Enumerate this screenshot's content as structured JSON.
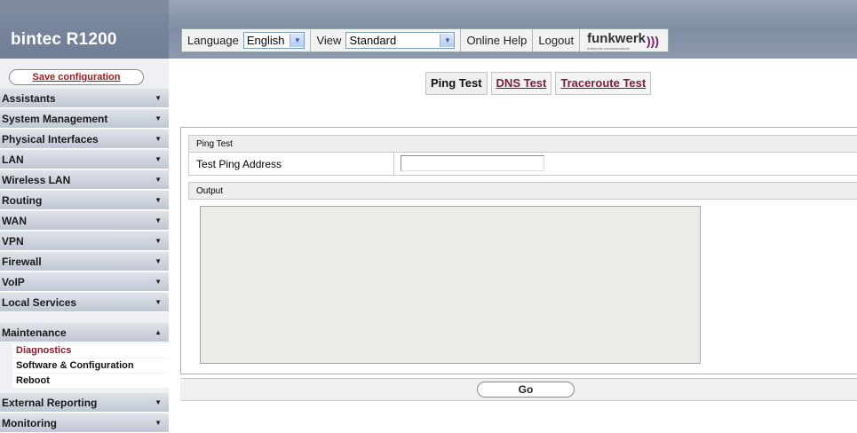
{
  "header": {
    "product": "bintec R1200",
    "language_label": "Language",
    "language_value": "English",
    "view_label": "View",
    "view_value": "Standard",
    "online_help": "Online Help",
    "logout": "Logout",
    "logo_text": "funkwerk",
    "logo_sub": "enterprise communications"
  },
  "sidebar": {
    "save_label": "Save configuration",
    "items": [
      {
        "label": "Assistants"
      },
      {
        "label": "System Management"
      },
      {
        "label": "Physical Interfaces"
      },
      {
        "label": "LAN"
      },
      {
        "label": "Wireless LAN"
      },
      {
        "label": "Routing"
      },
      {
        "label": "WAN"
      },
      {
        "label": "VPN"
      },
      {
        "label": "Firewall"
      },
      {
        "label": "VoIP"
      },
      {
        "label": "Local Services"
      },
      {
        "label": "Maintenance"
      },
      {
        "label": "External Reporting"
      },
      {
        "label": "Monitoring"
      }
    ],
    "subitems": [
      {
        "label": "Diagnostics"
      },
      {
        "label": "Software & Configuration"
      },
      {
        "label": "Reboot"
      }
    ]
  },
  "tabs": [
    {
      "label": "Ping Test"
    },
    {
      "label": "DNS Test"
    },
    {
      "label": "Traceroute Test"
    }
  ],
  "form": {
    "section_title": "Ping Test",
    "field_label": "Test Ping Address",
    "field_value": "",
    "output_title": "Output"
  },
  "buttons": {
    "go": "Go"
  },
  "colors": {
    "header_bg": "#8d99ad",
    "accent_link": "#7c1b3c",
    "sidebar_item_bg": "#bfc7d3"
  }
}
